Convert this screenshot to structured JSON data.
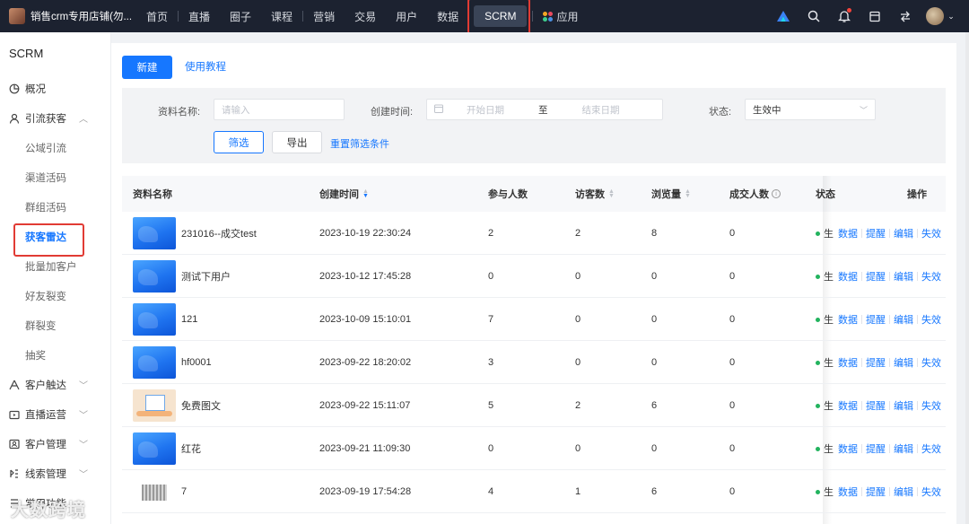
{
  "topbar": {
    "shop_name": "销售crm专用店铺(勿...",
    "nav": [
      "首页",
      "直播",
      "圈子",
      "课程",
      "营销",
      "交易",
      "用户",
      "数据",
      "SCRM"
    ],
    "active_nav": "SCRM",
    "apps_label": "应用",
    "icons": [
      "brand-icon",
      "search-icon",
      "bell-icon",
      "calendar-icon",
      "switch-icon",
      "user-avatar"
    ]
  },
  "sidebar": {
    "title": "SCRM",
    "overview": "概况",
    "lead_group": "引流获客",
    "lead_items": [
      "公域引流",
      "渠道活码",
      "群组活码",
      "获客雷达",
      "批量加客户",
      "好友裂变",
      "群裂变",
      "抽奖"
    ],
    "active_item": "获客雷达",
    "groups": [
      "客户触达",
      "直播运营",
      "客户管理",
      "线索管理",
      "常用功能"
    ]
  },
  "toolbar": {
    "new_label": "新建",
    "tutorial_label": "使用教程"
  },
  "filter": {
    "name_label": "资料名称:",
    "name_placeholder": "请输入",
    "time_label": "创建时间:",
    "start_placeholder": "开始日期",
    "to_label": "至",
    "end_placeholder": "结束日期",
    "status_label": "状态:",
    "status_value": "生效中",
    "filter_btn": "筛选",
    "export_btn": "导出",
    "reset_link": "重置筛选条件"
  },
  "table": {
    "headers": {
      "name": "资料名称",
      "created": "创建时间",
      "participants": "参与人数",
      "visitors": "访客数",
      "views": "浏览量",
      "deals": "成交人数",
      "status": "状态",
      "actions": "操作"
    },
    "status_text": "生",
    "action_labels": [
      "数据",
      "提醒",
      "编辑",
      "失效"
    ],
    "rows": [
      {
        "name": "231016--成交test",
        "created": "2023-10-19 22:30:24",
        "participants": "2",
        "visitors": "2",
        "views": "8",
        "deals": "0",
        "thumb": "blue"
      },
      {
        "name": "测试下用户",
        "created": "2023-10-12 17:45:28",
        "participants": "0",
        "visitors": "0",
        "views": "0",
        "deals": "0",
        "thumb": "blue"
      },
      {
        "name": "121",
        "created": "2023-10-09 15:10:01",
        "participants": "7",
        "visitors": "0",
        "views": "0",
        "deals": "0",
        "thumb": "blue"
      },
      {
        "name": "hf0001",
        "created": "2023-09-22 18:20:02",
        "participants": "3",
        "visitors": "0",
        "views": "0",
        "deals": "0",
        "thumb": "blue"
      },
      {
        "name": "免费图文",
        "created": "2023-09-22 15:11:07",
        "participants": "5",
        "visitors": "2",
        "views": "6",
        "deals": "0",
        "thumb": "tan"
      },
      {
        "name": "红花",
        "created": "2023-09-21 11:09:30",
        "participants": "0",
        "visitors": "0",
        "views": "0",
        "deals": "0",
        "thumb": "blue"
      },
      {
        "name": "7",
        "created": "2023-09-19 17:54:28",
        "participants": "4",
        "visitors": "1",
        "views": "6",
        "deals": "0",
        "thumb": "gray"
      }
    ]
  },
  "watermark": "大数跨境",
  "colors": {
    "accent": "#1677ff",
    "topbar": "#1c2230",
    "highlight": "#e13b34",
    "status": "#22b35e"
  }
}
